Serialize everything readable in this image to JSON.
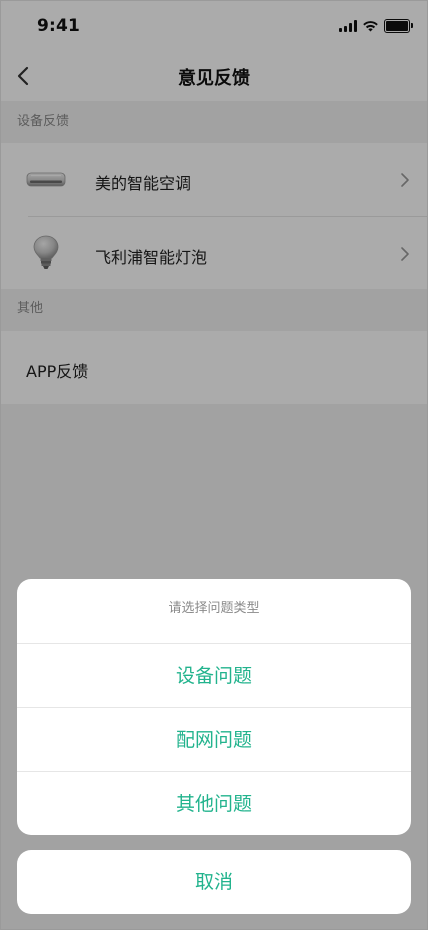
{
  "status_bar": {
    "time": "9:41"
  },
  "nav": {
    "title": "意见反馈"
  },
  "sections": {
    "device": {
      "header": "设备反馈",
      "items": [
        {
          "label": "美的智能空调",
          "icon": "air-conditioner-icon"
        },
        {
          "label": "飞利浦智能灯泡",
          "icon": "light-bulb-icon"
        }
      ]
    },
    "other": {
      "header": "其他",
      "items": [
        {
          "label": "APP反馈"
        }
      ]
    }
  },
  "action_sheet": {
    "title": "请选择问题类型",
    "options": [
      "设备问题",
      "配网问题",
      "其他问题"
    ],
    "cancel": "取消"
  },
  "colors": {
    "accent": "#22b38d",
    "overlay": "rgba(0,0,0,0.33)",
    "section_bg": "#f2f2f2"
  }
}
